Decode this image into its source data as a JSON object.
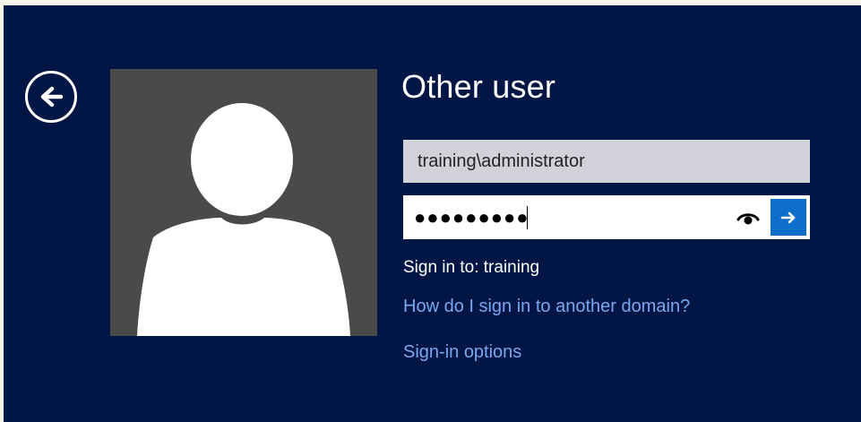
{
  "login": {
    "title": "Other user",
    "username_value": "training\\administrator",
    "password_masked": "●●●●●●●●●",
    "sign_in_to": "Sign in to: training",
    "help_link": "How do I sign in to another domain?",
    "options_link": "Sign-in options"
  },
  "icons": {
    "back": "back-arrow-icon",
    "avatar": "user-silhouette-icon",
    "reveal": "eye-icon",
    "submit": "arrow-right-icon"
  },
  "colors": {
    "background": "#021645",
    "accent": "#0d6fc9",
    "link": "#7aa6f0"
  }
}
